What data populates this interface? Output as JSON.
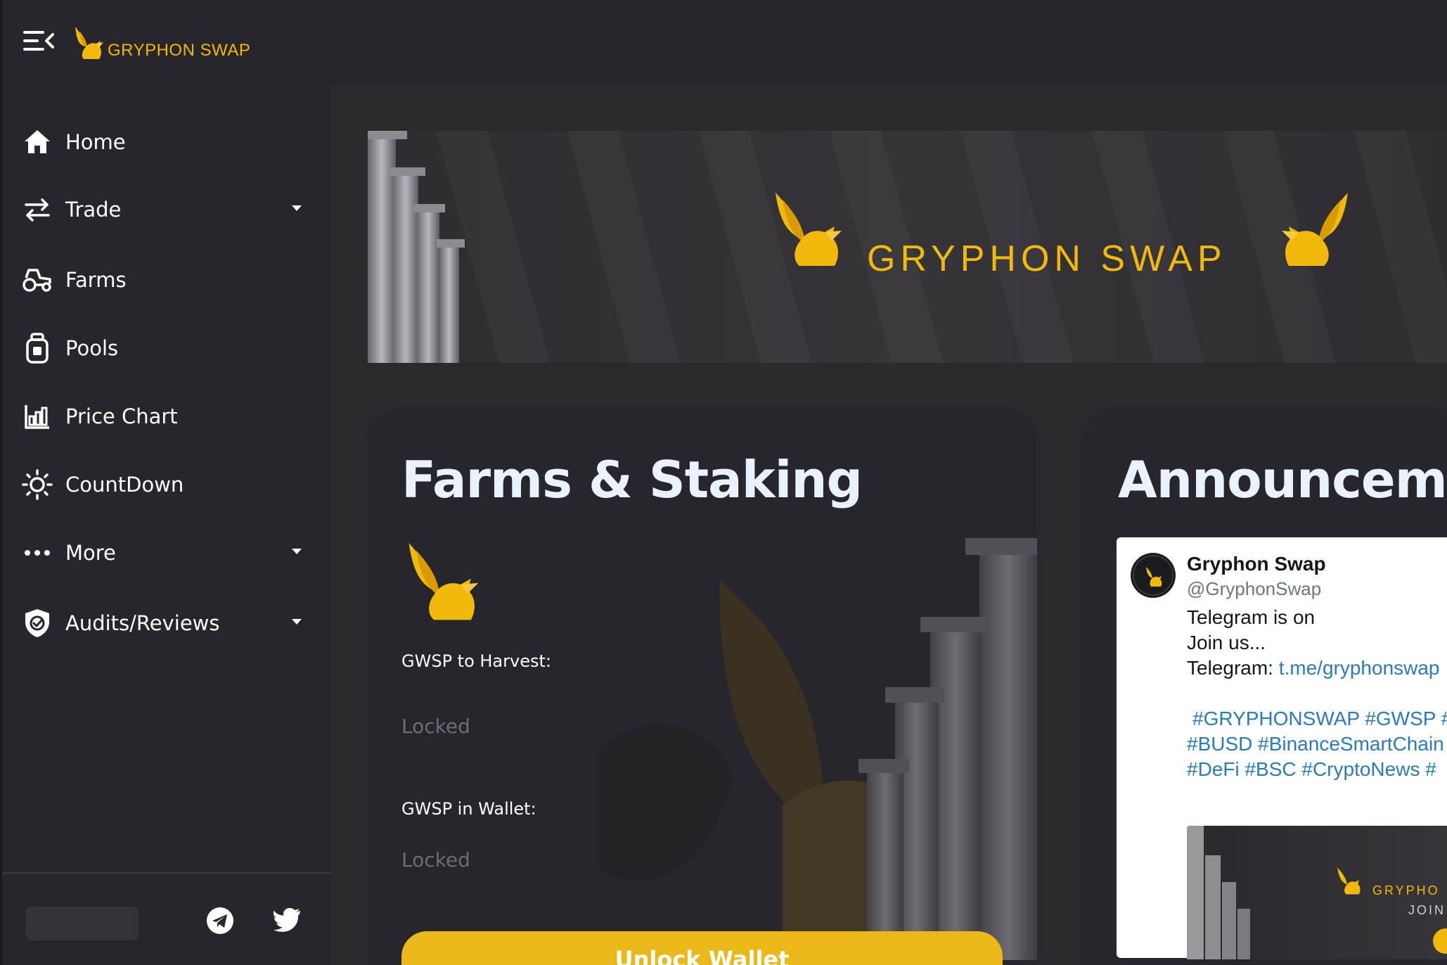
{
  "header": {
    "logo_text": "GRYPHON SWAP"
  },
  "sidebar": {
    "items": [
      {
        "label": "Home",
        "icon": "home-icon"
      },
      {
        "label": "Trade",
        "icon": "swap-arrows-icon",
        "has_submenu": true
      },
      {
        "label": "Farms",
        "icon": "tractor-icon"
      },
      {
        "label": "Pools",
        "icon": "pool-bag-icon"
      },
      {
        "label": "Price Chart",
        "icon": "chart-icon"
      },
      {
        "label": "CountDown",
        "icon": "sun-icon"
      },
      {
        "label": "More",
        "icon": "more-dots-icon",
        "has_submenu": true
      },
      {
        "label": "Audits/Reviews",
        "icon": "shield-check-icon",
        "has_submenu": true
      }
    ],
    "footer": {
      "social": [
        "telegram-icon",
        "twitter-icon"
      ]
    }
  },
  "hero": {
    "title": "GRYPHON SWAP"
  },
  "farms_card": {
    "heading": "Farms & Staking",
    "harvest_label": "GWSP to Harvest:",
    "harvest_value": "Locked",
    "wallet_label": "GWSP in Wallet:",
    "wallet_value": "Locked",
    "unlock_button": "Unlock Wallet"
  },
  "announcements_card": {
    "heading": "Announcements",
    "tweet": {
      "name": "Gryphon Swap",
      "handle": "@GryphonSwap",
      "line1": "Telegram is on",
      "line2": "Join us...",
      "line3_prefix": "Telegram: ",
      "line3_link": "t.me/gryphonswap",
      "tags1": "#GRYPHONSWAP #GWSP #",
      "tags2": "#BUSD  #BinanceSmartChain",
      "tags3": "#DeFi #BSC  #CryptoNews  #",
      "media_title": "GRYPHO",
      "media_sub": "JOIN"
    }
  },
  "colors": {
    "brand_gold": "#f0b90b",
    "button_gold": "#ebb819",
    "panel_bg": "#27262c",
    "page_bg": "#2b292e",
    "heading_text": "#eaf2ff",
    "muted_text": "#6e6b74",
    "link_blue": "#2b7bb9"
  }
}
